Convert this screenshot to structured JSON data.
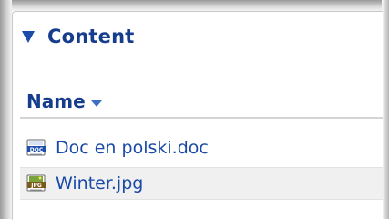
{
  "section": {
    "title": "Content",
    "expanded": true
  },
  "table": {
    "column_name": "Name",
    "sort": "descending",
    "rows": [
      {
        "name": "Doc en polski.doc",
        "icon": "doc-file-icon"
      },
      {
        "name": "Winter.jpg",
        "icon": "jpg-file-icon"
      }
    ]
  },
  "colors": {
    "link": "#1a4aa8",
    "header": "#163c8c",
    "row_alt": "#f0f0f0"
  }
}
